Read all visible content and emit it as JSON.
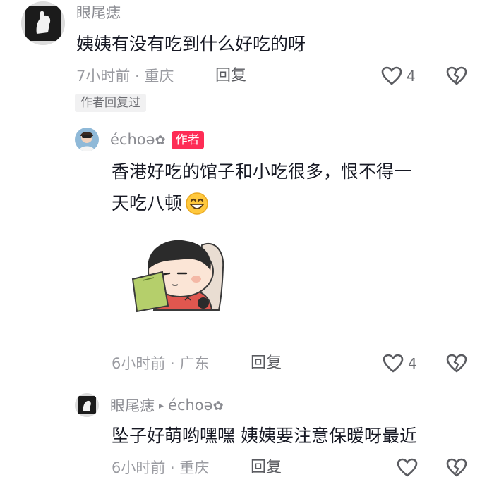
{
  "comments": [
    {
      "username": "眼尾痣",
      "text": "姨姨有没有吃到什么好吃的呀",
      "meta": "7小时前 · 重庆",
      "reply_label": "回复",
      "like_count": "4",
      "author_replied_badge": "作者回复过",
      "avatar_icon": "hand-photo-avatar"
    },
    {
      "username": "échoə",
      "username_suffix": "✿",
      "author_badge": "作者",
      "text_line1": "香港好吃的馆子和小吃很多，恨不得一",
      "text_line2": "天吃八顿",
      "emoji": "grin-emoji",
      "sticker": "cartoon-boy-holding-notebook-sticker",
      "meta": "6小时前 · 广东",
      "reply_label": "回复",
      "like_count": "4",
      "avatar_icon": "selfie-avatar"
    },
    {
      "username": "眼尾痣",
      "reply_arrow": "▸",
      "reply_to": "échoə",
      "reply_to_suffix": "✿",
      "text": "坠子好萌哟嘿嘿 姨姨要注意保暖呀最近",
      "meta": "6小时前 · 重庆",
      "reply_label": "回复",
      "like_count": "",
      "avatar_icon": "hand-photo-avatar"
    }
  ],
  "colors": {
    "author_badge_bg": "#fe2c55",
    "meta_text": "#9a9ba1",
    "body_text": "#161823"
  },
  "icons": [
    "heart-icon",
    "broken-heart-icon"
  ]
}
